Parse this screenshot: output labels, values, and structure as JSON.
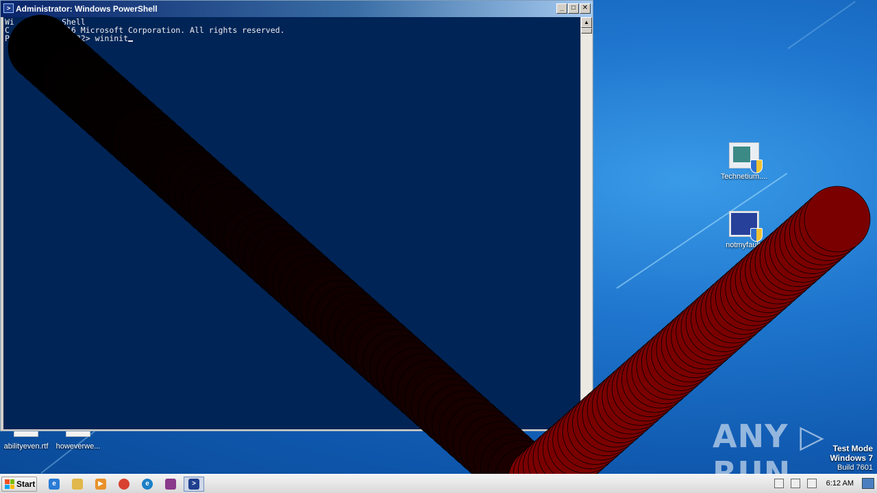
{
  "window": {
    "title": "Administrator: Windows PowerShell",
    "minimize_glyph": "_",
    "maximize_glyph": "□",
    "close_glyph": "✕",
    "console_lines": [
      "Wi          Shell",
      "C          2016 Microsoft Corporation. All rights reserved.",
      "",
      "P             m32> wininit"
    ]
  },
  "desktop": {
    "icons": [
      {
        "label": "Technetium....",
        "icon": "window-app-icon"
      },
      {
        "label": "notmyfault.",
        "icon": "bluescreen-app-icon"
      }
    ],
    "bottom_files": [
      {
        "label": "abilityeven.rtf"
      },
      {
        "label": "howeverwe..."
      }
    ],
    "watermark": "ANY ▷ RUN",
    "testmode": {
      "line1": "Test Mode",
      "line2": "Windows 7",
      "line3": "Build 7601"
    }
  },
  "taskbar": {
    "start_label": "Start",
    "clock": "6:12 AM",
    "items": [
      {
        "name": "ie-icon",
        "color": "#2a7bd6"
      },
      {
        "name": "explorer-icon",
        "color": "#e0b84a"
      },
      {
        "name": "media-player-icon",
        "color": "#e8912b"
      },
      {
        "name": "chrome-icon",
        "color": "#d8412f"
      },
      {
        "name": "edge-icon",
        "color": "#1b7fc7"
      },
      {
        "name": "winrar-icon",
        "color": "#8a3a8a"
      },
      {
        "name": "powershell-icon",
        "color": "#1f3f8f"
      }
    ]
  },
  "colors": {
    "console_bg": "#012456",
    "overlay_dark": "#1a0000",
    "overlay_red": "#7a0000"
  }
}
